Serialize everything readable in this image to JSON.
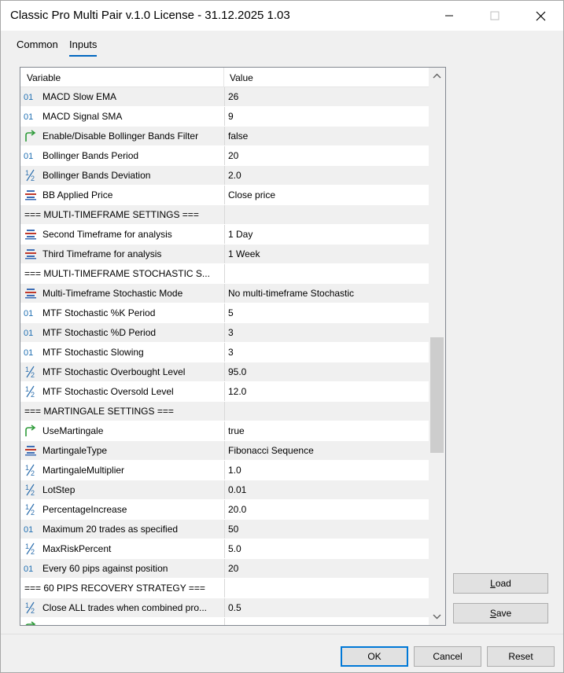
{
  "window": {
    "title": "Classic Pro Multi Pair v.1.0 License - 31.12.2025 1.03",
    "minimize_icon": "minimize-icon",
    "maximize_icon": "maximize-icon",
    "close_icon": "close-icon"
  },
  "tabs": [
    {
      "label": "Common",
      "active": false
    },
    {
      "label": "Inputs",
      "active": true
    }
  ],
  "grid": {
    "header": {
      "variable": "Variable",
      "value": "Value"
    },
    "rows": [
      {
        "icon": "int",
        "variable": "MACD Slow EMA",
        "value": "26"
      },
      {
        "icon": "int",
        "variable": "MACD Signal SMA",
        "value": "9"
      },
      {
        "icon": "bool",
        "variable": "Enable/Disable Bollinger Bands Filter",
        "value": "false"
      },
      {
        "icon": "int",
        "variable": "Bollinger Bands Period",
        "value": "20"
      },
      {
        "icon": "double",
        "variable": "Bollinger Bands Deviation",
        "value": "2.0"
      },
      {
        "icon": "enum",
        "variable": "BB Applied Price",
        "value": "Close price"
      },
      {
        "icon": "none",
        "variable": "=== MULTI-TIMEFRAME SETTINGS ===",
        "value": ""
      },
      {
        "icon": "enum",
        "variable": "Second Timeframe for analysis",
        "value": "1 Day"
      },
      {
        "icon": "enum",
        "variable": "Third Timeframe for analysis",
        "value": "1 Week"
      },
      {
        "icon": "none",
        "variable": "=== MULTI-TIMEFRAME STOCHASTIC S...",
        "value": ""
      },
      {
        "icon": "enum",
        "variable": "Multi-Timeframe Stochastic Mode",
        "value": "No multi-timeframe Stochastic"
      },
      {
        "icon": "int",
        "variable": "MTF Stochastic %K Period",
        "value": "5"
      },
      {
        "icon": "int",
        "variable": "MTF Stochastic %D Period",
        "value": "3"
      },
      {
        "icon": "int",
        "variable": "MTF Stochastic Slowing",
        "value": "3"
      },
      {
        "icon": "double",
        "variable": "MTF Stochastic Overbought Level",
        "value": "95.0"
      },
      {
        "icon": "double",
        "variable": "MTF Stochastic Oversold Level",
        "value": "12.0"
      },
      {
        "icon": "none",
        "variable": "=== MARTINGALE SETTINGS ===",
        "value": ""
      },
      {
        "icon": "bool",
        "variable": "UseMartingale",
        "value": "true"
      },
      {
        "icon": "enum",
        "variable": "MartingaleType",
        "value": "Fibonacci Sequence"
      },
      {
        "icon": "double",
        "variable": "MartingaleMultiplier",
        "value": "1.0"
      },
      {
        "icon": "double",
        "variable": "LotStep",
        "value": "0.01"
      },
      {
        "icon": "double",
        "variable": "PercentageIncrease",
        "value": "20.0"
      },
      {
        "icon": "int",
        "variable": "Maximum 20 trades as specified",
        "value": "50"
      },
      {
        "icon": "double",
        "variable": "MaxRiskPercent",
        "value": "5.0"
      },
      {
        "icon": "int",
        "variable": "Every 60 pips against position",
        "value": "20"
      },
      {
        "icon": "none",
        "variable": "=== 60 PIPS RECOVERY STRATEGY ===",
        "value": ""
      },
      {
        "icon": "double",
        "variable": "Close ALL trades when combined pro...",
        "value": "0.5"
      },
      {
        "icon": "bool",
        "variable": "",
        "value": ""
      }
    ],
    "scrollbar": {
      "position": 0.62,
      "visible_fraction": 0.22
    }
  },
  "side_buttons": {
    "load": "Load",
    "save": "Save"
  },
  "footer": {
    "ok": "OK",
    "cancel": "Cancel",
    "reset": "Reset"
  },
  "colors": {
    "accent": "#0078d7",
    "int_icon": "#1f6fb2",
    "bool_icon": "#2e9b3a",
    "enum_icon": "#3d6db5",
    "double_icon": "#2d6fae"
  }
}
